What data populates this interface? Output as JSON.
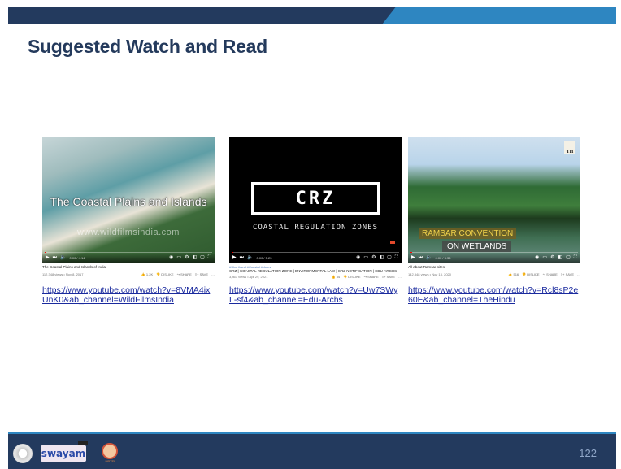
{
  "slide": {
    "title": "Suggested Watch and Read",
    "page_number": "122"
  },
  "cards": [
    {
      "overlay": "The Coastal Plains and Islands",
      "watermark": "www.wildfilmsindia.com",
      "time": "0:00 / 4:14",
      "video_title": "The Coastal Plains and Islands of India",
      "views": "112,348 views • Nov 8, 2017",
      "likes": "1.2K",
      "link": "https://www.youtube.com/watch?v=8VMA4ixUnK0&ab_channel=WildFilmsIndia"
    },
    {
      "overlay": "CRZ",
      "subtitle": "COASTAL REGULATION ZONES",
      "time": "0:00 / 5:23",
      "category": "#Shorthand #Coastal #Notes",
      "video_title": "CRZ | COASTAL REGULATION ZONE | ENVIRONMENTAL LAW | CRZ NOTIFICATION | EDU-ARCHS",
      "views": "3,863 views • Apr 29, 2021",
      "likes": "54",
      "link": "https://www.youtube.com/watch?v=Uw7SWyL-sf4&ab_channel=Edu-Archs"
    },
    {
      "overlay_line1": "RAMSAR CONVENTION",
      "overlay_line2": "ON WETLANDS",
      "badge": "TH",
      "time": "0:00 / 3:36",
      "video_title": "All about Ramsar sites",
      "views": "142,348 views • Nov 13, 2020",
      "likes": "516",
      "link": "https://www.youtube.com/watch?v=Rcl8sP2e60E&ab_channel=TheHindu"
    }
  ],
  "actions": {
    "dislike": "DISLIKE",
    "share": "SHARE",
    "save": "SAVE"
  },
  "footer": {
    "swayam": "swayam",
    "nptel": "NPTEL"
  }
}
